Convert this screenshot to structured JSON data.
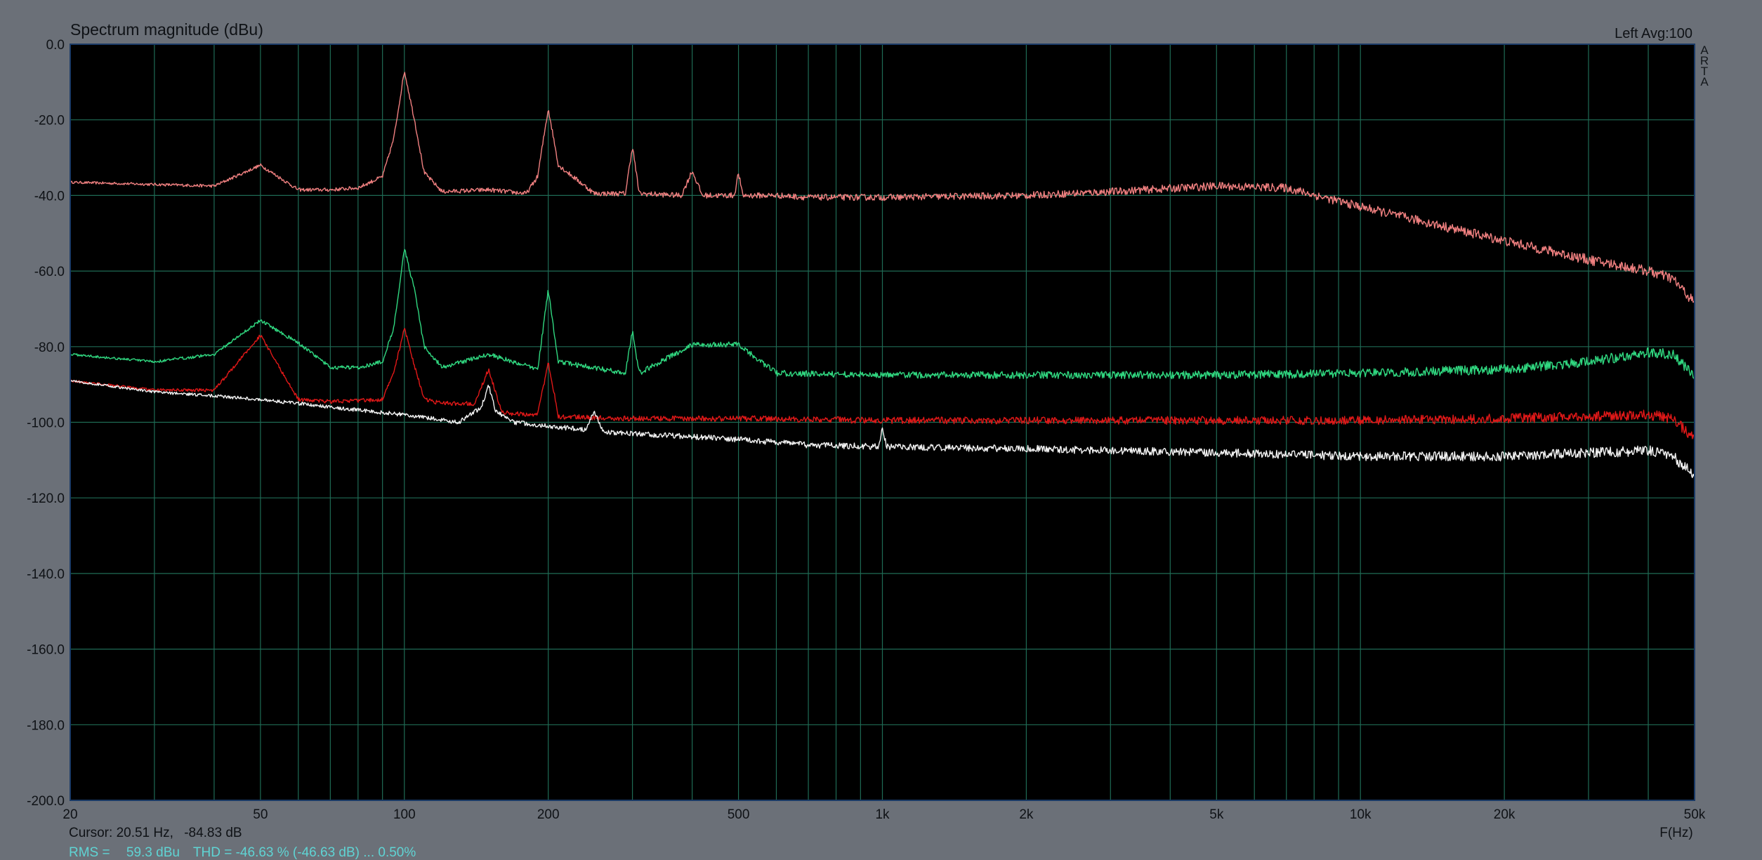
{
  "chart_data": {
    "type": "line",
    "title": "Spectrum magnitude (dBu)",
    "channel_info": "Left  Avg:100",
    "brand_letters": [
      "A",
      "R",
      "T",
      "A"
    ],
    "xlabel": "F(Hz)",
    "ylabel": "",
    "x_scale": "log",
    "xlim": [
      20,
      50000
    ],
    "ylim": [
      -200,
      0
    ],
    "grid": true,
    "background": "#000000",
    "grid_color": "#1f6b55",
    "y_ticks": [
      "0.0",
      "-20.0",
      "-40.0",
      "-60.0",
      "-80.0",
      "-100.0",
      "-120.0",
      "-140.0",
      "-160.0",
      "-180.0",
      "-200.0"
    ],
    "y_tick_values": [
      0,
      -20,
      -40,
      -60,
      -80,
      -100,
      -120,
      -140,
      -160,
      -180,
      -200
    ],
    "x_ticks": [
      "20",
      "50",
      "100",
      "200",
      "500",
      "1k",
      "2k",
      "5k",
      "10k",
      "20k",
      "50k"
    ],
    "x_tick_values": [
      20,
      50,
      100,
      200,
      500,
      1000,
      2000,
      5000,
      10000,
      20000,
      50000
    ],
    "series": [
      {
        "color": "#f08080",
        "x": [
          20,
          40,
          50,
          60,
          70,
          80,
          90,
          95,
          100,
          105,
          110,
          120,
          150,
          180,
          190,
          200,
          210,
          250,
          290,
          300,
          310,
          380,
          400,
          420,
          490,
          500,
          510,
          600,
          700,
          1000,
          2000,
          3000,
          5000,
          7000,
          10000,
          20000,
          30000,
          40000,
          45000,
          50000
        ],
        "y": [
          -36.5,
          -37.5,
          -32,
          -38.5,
          -38.5,
          -38,
          -35,
          -25,
          -7,
          -20,
          -34,
          -39,
          -38.5,
          -39.5,
          -35,
          -17,
          -32,
          -39.5,
          -39.5,
          -27,
          -39.5,
          -40,
          -33.5,
          -40,
          -40,
          -34,
          -40,
          -40,
          -40.5,
          -40.5,
          -40,
          -39,
          -37.5,
          -38,
          -43,
          -52,
          -57,
          -60,
          -62,
          -68.5
        ]
      },
      {
        "color": "#30d880",
        "x": [
          20,
          30,
          40,
          50,
          60,
          70,
          80,
          90,
          95,
          100,
          105,
          110,
          120,
          150,
          190,
          200,
          210,
          290,
          300,
          310,
          400,
          500,
          600,
          1000,
          2000,
          5000,
          10000,
          20000,
          30000,
          40000,
          45000,
          50000
        ],
        "y": [
          -82,
          -84,
          -82,
          -73,
          -79,
          -85.5,
          -85.5,
          -84,
          -75,
          -54,
          -65,
          -80,
          -85.5,
          -82,
          -86,
          -65,
          -84,
          -87,
          -76,
          -87,
          -79.5,
          -79.5,
          -87,
          -87.5,
          -87.5,
          -87.5,
          -87,
          -86,
          -84,
          -81.5,
          -82,
          -87.5
        ]
      },
      {
        "color": "#e01818",
        "x": [
          20,
          30,
          40,
          50,
          60,
          70,
          90,
          95,
          100,
          105,
          110,
          120,
          140,
          150,
          160,
          190,
          200,
          210,
          300,
          500,
          1000,
          2000,
          5000,
          10000,
          20000,
          40000,
          45000,
          50000
        ],
        "y": [
          -89,
          -91.5,
          -91.5,
          -77,
          -94,
          -94.5,
          -94,
          -87,
          -75,
          -85,
          -94,
          -95,
          -95,
          -86,
          -97.5,
          -98,
          -84,
          -98.5,
          -99,
          -99,
          -99.5,
          -99.5,
          -99.5,
          -99.5,
          -99,
          -98,
          -99,
          -104.5
        ]
      },
      {
        "color": "#f2f2f2",
        "x": [
          20,
          30,
          40,
          50,
          60,
          70,
          100,
          130,
          145,
          150,
          155,
          170,
          200,
          240,
          250,
          260,
          300,
          500,
          700,
          980,
          1000,
          1020,
          2000,
          3000,
          5000,
          10000,
          20000,
          40000,
          45000,
          50000
        ],
        "y": [
          -89,
          -92,
          -93,
          -94,
          -95,
          -96,
          -98,
          -100,
          -96,
          -90,
          -97,
          -100,
          -101,
          -102,
          -97,
          -102.5,
          -103,
          -104.5,
          -106,
          -106.5,
          -101.5,
          -106.5,
          -107,
          -107.5,
          -108,
          -109,
          -109,
          -107.5,
          -109,
          -114
        ]
      }
    ]
  },
  "status": {
    "cursor_label": "Cursor: 20.51 Hz,",
    "cursor_value": "-84.83 dB",
    "rms_label": "RMS =",
    "rms_value": "59.3 dBu",
    "thd_text": "THD = -46.63 % (-46.63 dB) ... 0.50%"
  }
}
